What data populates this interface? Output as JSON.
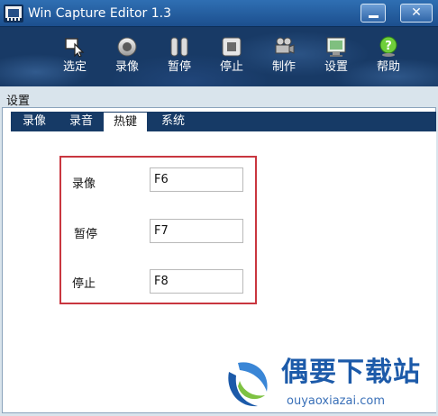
{
  "window": {
    "title": "Win Capture Editor 1.3"
  },
  "titlebar": {
    "minimize_label": "—",
    "close_label": "✕"
  },
  "toolbar": {
    "items": [
      {
        "label": "选定",
        "icon": "select-cursor-icon"
      },
      {
        "label": "录像",
        "icon": "record-icon"
      },
      {
        "label": "暂停",
        "icon": "pause-icon"
      },
      {
        "label": "停止",
        "icon": "stop-icon"
      },
      {
        "label": "制作",
        "icon": "film-camera-icon"
      },
      {
        "label": "设置",
        "icon": "settings-screen-icon"
      },
      {
        "label": "帮助",
        "icon": "help-icon"
      }
    ]
  },
  "settings": {
    "title": "设置",
    "tabs": [
      {
        "label": "录像",
        "active": false
      },
      {
        "label": "录音",
        "active": false
      },
      {
        "label": "热键",
        "active": true
      },
      {
        "label": "系统",
        "active": false
      }
    ],
    "hotkeys": [
      {
        "label": "录像",
        "value": "F6"
      },
      {
        "label": "暂停",
        "value": "F7"
      },
      {
        "label": "停止",
        "value": "F8"
      }
    ]
  },
  "watermark": {
    "brand": "偶要下载站",
    "url": "ouyaoxiazai.com"
  },
  "colors": {
    "title_bar": "#1c4f8e",
    "toolbar": "#183a66",
    "tab_bar": "#163a66",
    "group_border": "#c9363f",
    "brand": "#1c5aa9"
  }
}
